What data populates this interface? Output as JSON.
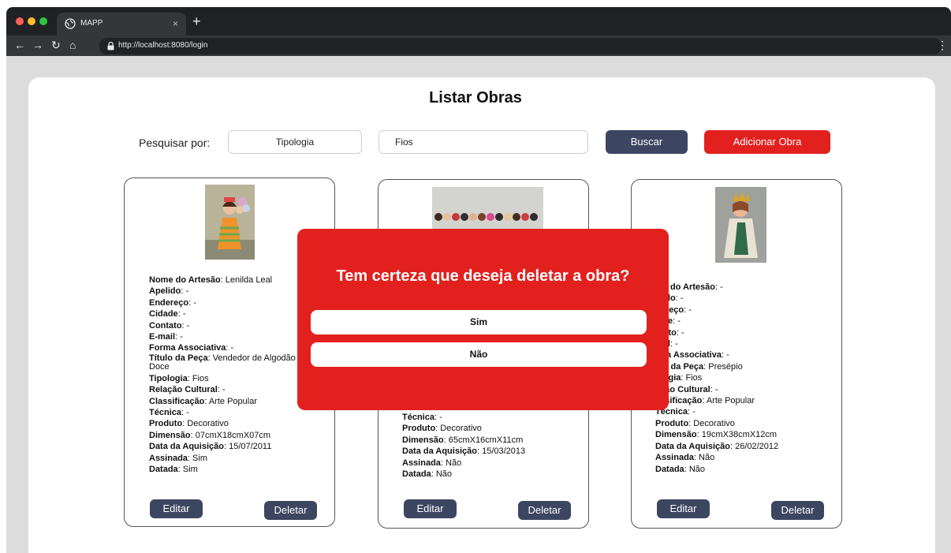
{
  "browser": {
    "tab_title": "MAPP",
    "tab_close": "×",
    "new_tab": "+",
    "url": "http://localhost:8080/login",
    "colors": {
      "close": "#ff5f57",
      "minimize": "#febc2e",
      "maximize": "#28c840"
    }
  },
  "page": {
    "title": "Listar Obras"
  },
  "search": {
    "label": "Pesquisar por:",
    "type_value": "Tipologia",
    "query_value": "Fios",
    "search_button": "Buscar",
    "add_button": "Adicionar Obra"
  },
  "cards": [
    {
      "photo": "amigurumi-doll-with-balloons",
      "artisan_name_label": "Nome do Artesão",
      "artisan_name": "Lenilda Leal",
      "nickname_label": "Apelido",
      "nickname": "-",
      "address_label": "Endereço",
      "address": "-",
      "city_label": "Cidade",
      "city": "-",
      "contact_label": "Contato",
      "contact": "-",
      "email_label": "E-mail",
      "email": "-",
      "association_label": "Forma Associativa",
      "association": "-",
      "piece_title_label": "Título da Peça",
      "piece_title": "Vendedor de Algodão Doce",
      "typology_label": "Tipologia",
      "typology": "Fios",
      "cultural_label": "Relação Cultural",
      "cultural": "-",
      "classification_label": "Classificação",
      "classification": "Arte Popular",
      "technique_label": "Técnica",
      "technique": "-",
      "product_label": "Produto",
      "product": "Decorativo",
      "dimension_label": "Dimensão",
      "dimension": "07cmX18cmX07cm",
      "acquisition_label": "Data da Aquisição",
      "acquisition": "15/07/2011",
      "signed_label": "Assinada",
      "signed": "Sim",
      "dated_label": "Datada",
      "dated": "Sim",
      "edit_button": "Editar",
      "delete_button": "Deletar"
    },
    {
      "photo": "row-of-crochet-dolls",
      "technique_label": "Técnica",
      "technique": "-",
      "product_label": "Produto",
      "product": "Decorativo",
      "dimension_label": "Dimensão",
      "dimension": "65cmX16cmX11cm",
      "acquisition_label": "Data da Aquisição",
      "acquisition": "15/03/2013",
      "signed_label": "Assinada",
      "signed": "Não",
      "dated_label": "Datada",
      "dated": "Não",
      "edit_button": "Editar",
      "delete_button": "Deletar"
    },
    {
      "photo": "crochet-saint-figure",
      "artisan_name_partial": "me do Artesão",
      "artisan_name": "-",
      "nickname_partial": "elido",
      "nickname": "-",
      "address_partial": "dereço",
      "address": "-",
      "city_partial": "lade",
      "city": "-",
      "contact_partial": "ntato",
      "contact": "-",
      "email_partial": "nail",
      "email": "-",
      "association_partial": "rma Associativa",
      "association": "-",
      "piece_title_partial": "ulo da Peça",
      "piece_title": "Presépio",
      "typology_partial": "ologia",
      "typology": "Fios",
      "cultural_partial": "ação Cultural",
      "cultural": "-",
      "classification_partial": "assificação",
      "classification": "Arte Popular",
      "technique_label": "Técnica",
      "technique": "-",
      "product_label": "Produto",
      "product": "Decorativo",
      "dimension_label": "Dimensão",
      "dimension": "19cmX38cmX12cm",
      "acquisition_label": "Data da Aquisição",
      "acquisition": "26/02/2012",
      "signed_label": "Assinada",
      "signed": "Não",
      "dated_label": "Datada",
      "dated": "Não",
      "edit_button": "Editar",
      "delete_button": "Deletar"
    }
  ],
  "modal": {
    "question": "Tem certeza que deseja deletar a obra?",
    "confirm": "Sim",
    "cancel": "Não",
    "color": "#e2211f"
  }
}
